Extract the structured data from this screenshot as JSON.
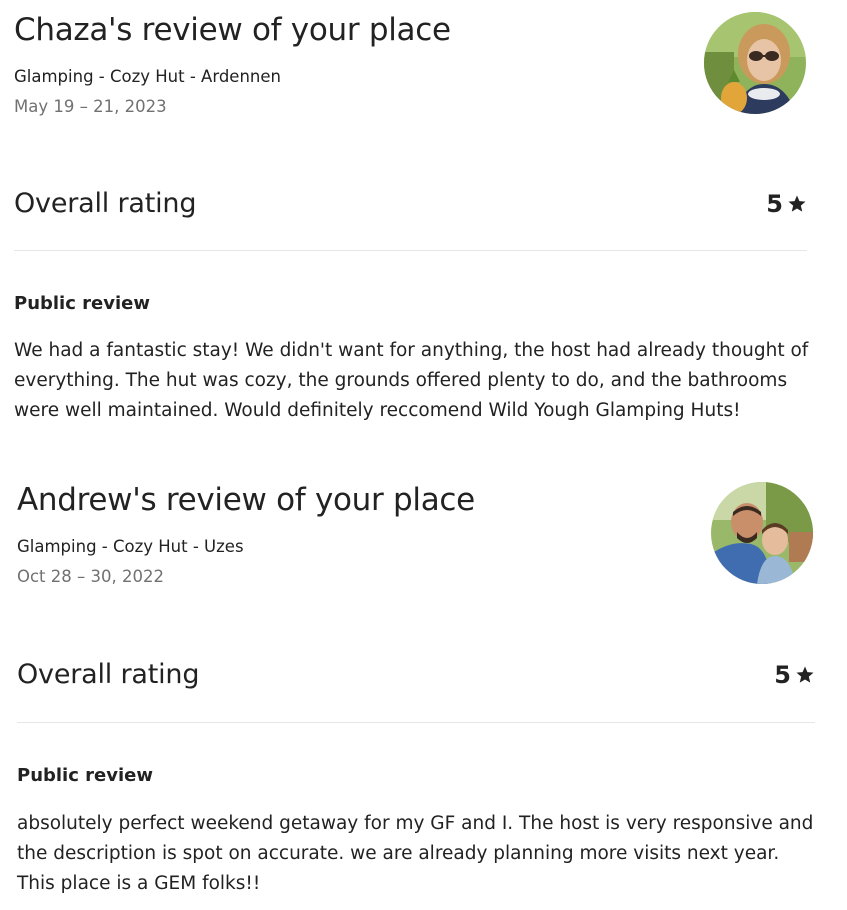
{
  "reviews": [
    {
      "title": "Chaza's review of your place",
      "listing": "Glamping - Cozy Hut - Ardennen",
      "dates": "May 19 – 21, 2023",
      "rating_label": "Overall rating",
      "rating_value": "5",
      "public_review_label": "Public review",
      "text": "We had a fantastic stay! We didn't want for anything, the host had already thought of everything. The hut was cozy, the grounds offered plenty to do, and the bathrooms were well maintained. Would definitely reccomend Wild Yough Glamping Huts!",
      "avatar_icon": "reviewer-photo"
    },
    {
      "title": "Andrew's review of your place",
      "listing": "Glamping - Cozy Hut - Uzes",
      "dates": "Oct 28 – 30, 2022",
      "rating_label": "Overall rating",
      "rating_value": "5",
      "public_review_label": "Public review",
      "text": "absolutely perfect weekend getaway for my GF and I. The host is very responsive and the description is spot on accurate. we are already planning more visits next year. This place is a GEM folks!!",
      "avatar_icon": "reviewer-photo"
    }
  ],
  "colors": {
    "text_primary": "#222222",
    "text_secondary": "#717171",
    "divider": "#e6e6e6"
  }
}
